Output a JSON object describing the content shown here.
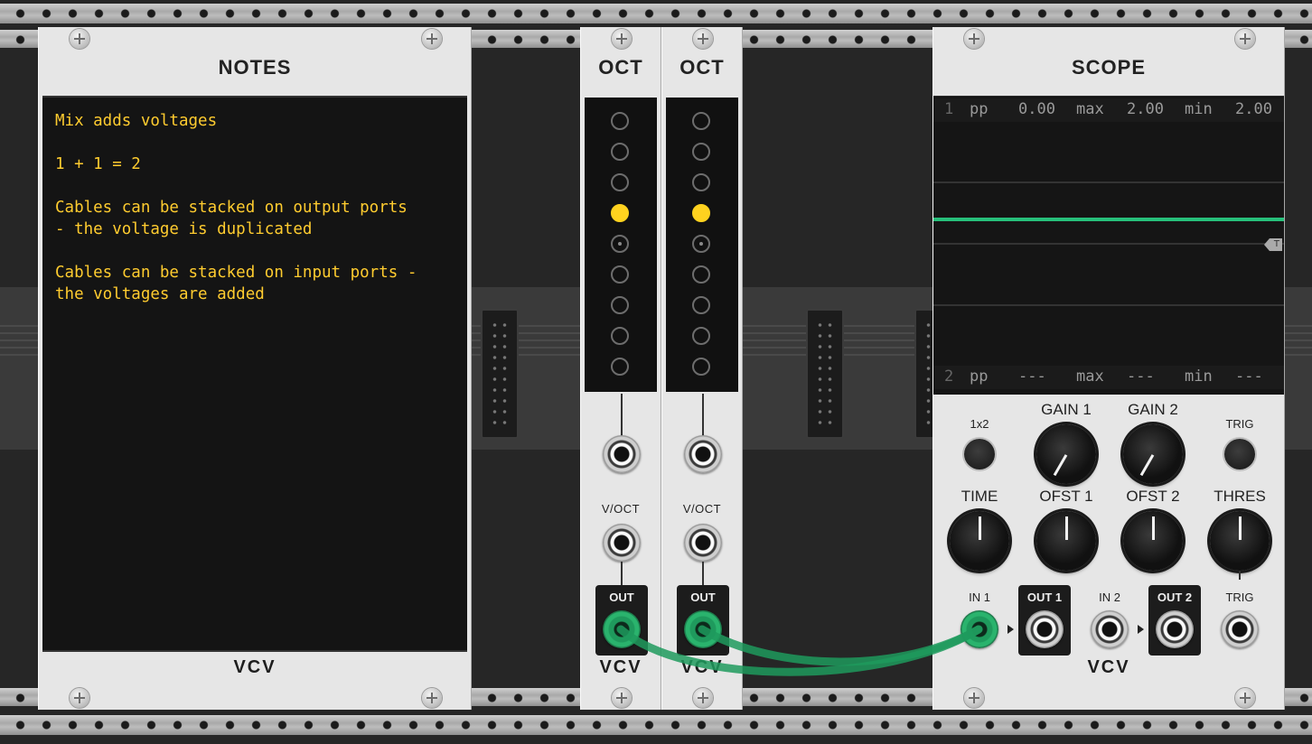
{
  "notes": {
    "title": "NOTES",
    "text": "Mix adds voltages\n\n1 + 1 = 2\n\nCables can be stacked on output ports\n- the voltage is duplicated\n\nCables can be stacked on input ports -\nthe voltages are added",
    "logo": "VCV"
  },
  "octave_modules": [
    {
      "title": "OCT",
      "active_led": 3,
      "zero_led": 4,
      "in_label": "V/OCT",
      "out_label": "OUT",
      "logo": "VCV"
    },
    {
      "title": "OCT",
      "active_led": 3,
      "zero_led": 4,
      "in_label": "V/OCT",
      "out_label": "OUT",
      "logo": "VCV"
    }
  ],
  "scope": {
    "title": "SCOPE",
    "stats1": {
      "ch": "1",
      "pp_label": "pp",
      "pp": "0.00",
      "max_label": "max",
      "max": "2.00",
      "min_label": "min",
      "min": "2.00"
    },
    "stats2": {
      "ch": "2",
      "pp_label": "pp",
      "pp": "---",
      "max_label": "max",
      "max": "---",
      "min_label": "min",
      "min": "---"
    },
    "trig_marker": "T",
    "labels": {
      "mode": "1x2",
      "gain1": "GAIN 1",
      "gain2": "GAIN 2",
      "trig_btn": "TRIG",
      "time": "TIME",
      "ofst1": "OFST 1",
      "ofst2": "OFST 2",
      "thres": "THRES",
      "in1": "IN 1",
      "out1": "OUT 1",
      "in2": "IN 2",
      "out2": "OUT 2",
      "trig_in": "TRIG"
    },
    "logo": "VCV",
    "trace_color": "#27c07b"
  },
  "colors": {
    "led_on": "#ffd21f",
    "notes_text": "#ffcc2f",
    "cable": "#1f9a5d"
  }
}
